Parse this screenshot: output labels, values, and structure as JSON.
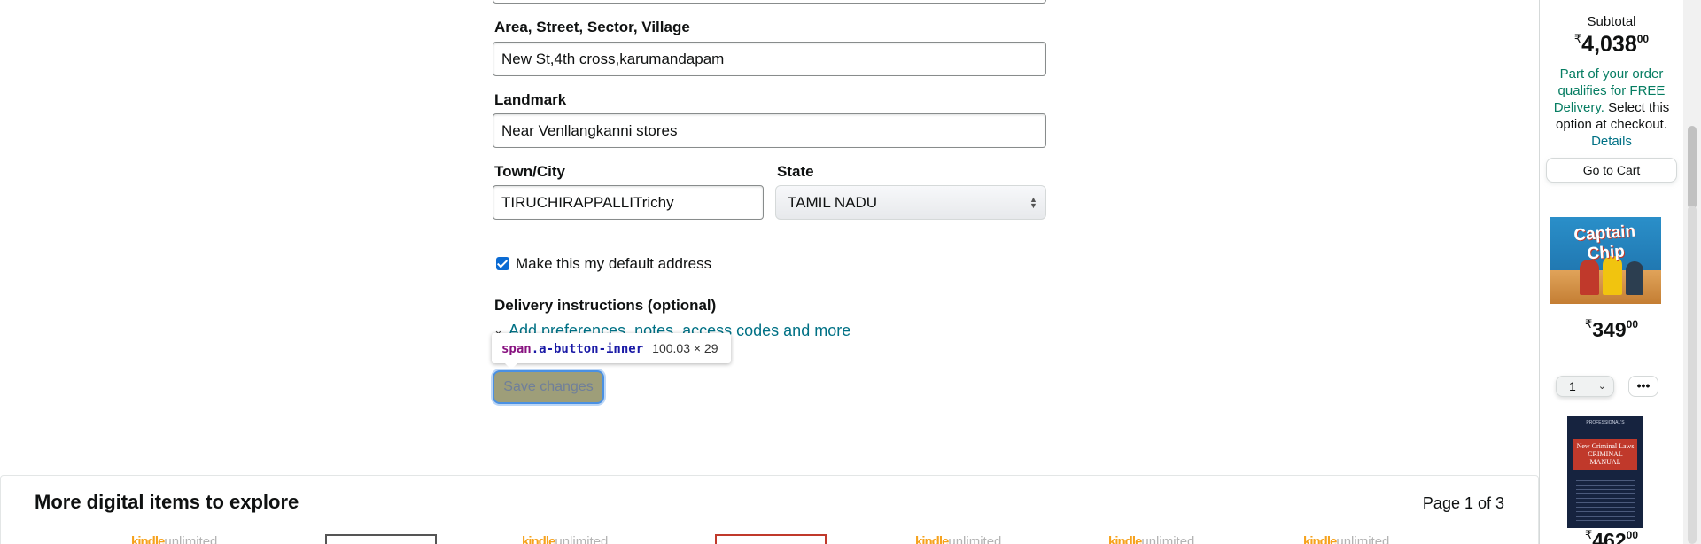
{
  "address_form": {
    "area_label": "Area, Street, Sector, Village",
    "area_value": "New St,4th cross,karumandapam",
    "landmark_label": "Landmark",
    "landmark_value": "Near Venllangkanni stores",
    "town_label": "Town/City",
    "town_value": "TIRUCHIRAPPALLITrichy",
    "state_label": "State",
    "state_value": "TAMIL NADU",
    "default_label": "Make this my default address",
    "default_checked": true,
    "delivery_heading": "Delivery instructions (optional)",
    "delivery_link": "Add preferences, notes, access codes and more",
    "save_label": "Save changes"
  },
  "devtools_tooltip": {
    "selector_tag": "span",
    "selector_class": ".a-button-inner",
    "dimensions": "100.03 × 29"
  },
  "digital": {
    "title": "More digital items to explore",
    "page_indicator": "Page 1 of 3",
    "kindle_k": "kindle",
    "kindle_u": "unlimited"
  },
  "cart": {
    "subtotal_label": "Subtotal",
    "subtotal_symbol": "₹",
    "subtotal_whole": "4,038",
    "subtotal_fraction": "00",
    "delivery_green": "Part of your order qualifies for FREE Delivery.",
    "delivery_dark": "Select this option at checkout.",
    "details_link": "Details",
    "goto_label": "Go to Cart",
    "item1": {
      "cover_title": "Captain Chip",
      "price_symbol": "₹",
      "price_whole": "349",
      "price_fraction": "00",
      "qty": "1",
      "more_label": "•••"
    },
    "item2": {
      "cover_top": "PROFESSIONAL'S",
      "cover_title": "New Criminal Laws CRIMINAL MANUAL",
      "price_symbol": "₹",
      "price_whole": "462",
      "price_fraction": "00"
    }
  }
}
